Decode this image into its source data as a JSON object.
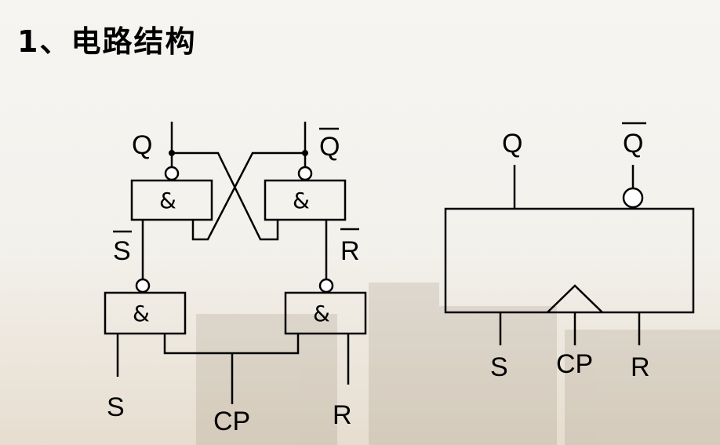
{
  "slide": {
    "title": "1、电路结构"
  },
  "left_circuit": {
    "gate_symbol": "&",
    "labels": {
      "Q": "Q",
      "Q_bar": "Q",
      "S_bar": "S",
      "R_bar": "R",
      "S": "S",
      "R": "R",
      "CP": "CP"
    }
  },
  "right_symbol": {
    "labels": {
      "Q": "Q",
      "Q_bar": "Q",
      "S": "S",
      "CP": "CP",
      "R": "R"
    }
  }
}
